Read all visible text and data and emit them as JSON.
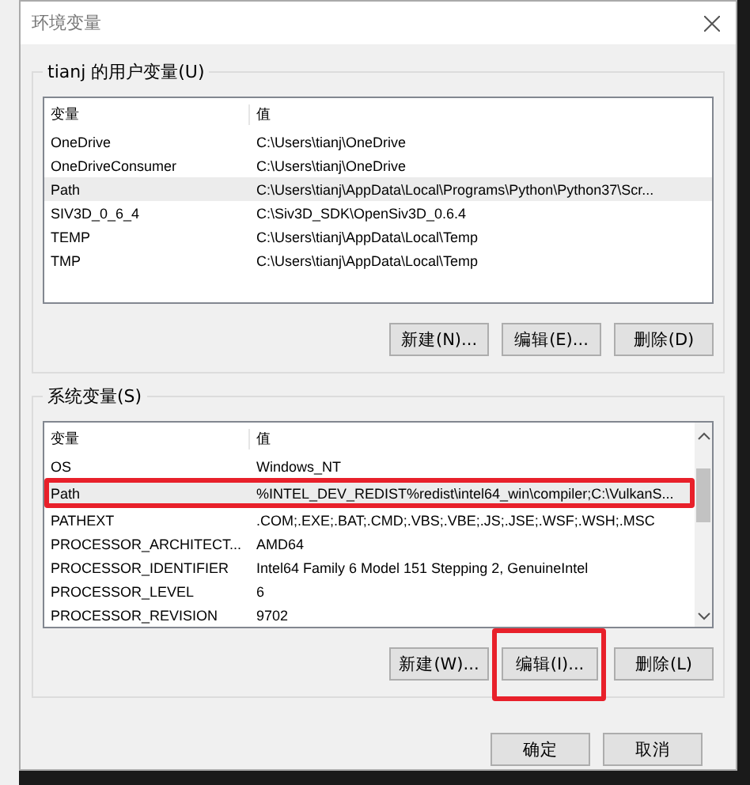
{
  "window": {
    "title": "环境变量"
  },
  "user_vars": {
    "label": "tianj 的用户变量(U)",
    "columns": [
      "变量",
      "值"
    ],
    "rows": [
      {
        "name": "OneDrive",
        "value": "C:\\Users\\tianj\\OneDrive",
        "selected": false,
        "annotated": false
      },
      {
        "name": "OneDriveConsumer",
        "value": "C:\\Users\\tianj\\OneDrive",
        "selected": false,
        "annotated": false
      },
      {
        "name": "Path",
        "value": "C:\\Users\\tianj\\AppData\\Local\\Programs\\Python\\Python37\\Scr...",
        "selected": true,
        "annotated": false
      },
      {
        "name": "SIV3D_0_6_4",
        "value": "C:\\Siv3D_SDK\\OpenSiv3D_0.6.4",
        "selected": false,
        "annotated": false
      },
      {
        "name": "TEMP",
        "value": "C:\\Users\\tianj\\AppData\\Local\\Temp",
        "selected": false,
        "annotated": false
      },
      {
        "name": "TMP",
        "value": "C:\\Users\\tianj\\AppData\\Local\\Temp",
        "selected": false,
        "annotated": false
      }
    ],
    "buttons": [
      {
        "label": "新建(N)...",
        "annotated": false
      },
      {
        "label": "编辑(E)...",
        "annotated": false
      },
      {
        "label": "删除(D)",
        "annotated": false
      }
    ]
  },
  "system_vars": {
    "label": "系统变量(S)",
    "columns": [
      "变量",
      "值"
    ],
    "rows": [
      {
        "name": "OS",
        "value": "Windows_NT",
        "selected": false,
        "annotated": false
      },
      {
        "name": "Path",
        "value": "%INTEL_DEV_REDIST%redist\\intel64_win\\compiler;C:\\VulkanS...",
        "selected": true,
        "annotated": true
      },
      {
        "name": "PATHEXT",
        "value": ".COM;.EXE;.BAT;.CMD;.VBS;.VBE;.JS;.JSE;.WSF;.WSH;.MSC",
        "selected": false,
        "annotated": false
      },
      {
        "name": "PROCESSOR_ARCHITECT...",
        "value": "AMD64",
        "selected": false,
        "annotated": false
      },
      {
        "name": "PROCESSOR_IDENTIFIER",
        "value": "Intel64 Family 6 Model 151 Stepping 2, GenuineIntel",
        "selected": false,
        "annotated": false
      },
      {
        "name": "PROCESSOR_LEVEL",
        "value": "6",
        "selected": false,
        "annotated": false
      },
      {
        "name": "PROCESSOR_REVISION",
        "value": "9702",
        "selected": false,
        "annotated": false
      }
    ],
    "buttons": [
      {
        "label": "新建(W)...",
        "annotated": false
      },
      {
        "label": "编辑(I)...",
        "annotated": true
      },
      {
        "label": "删除(L)",
        "annotated": false
      }
    ]
  },
  "footer_buttons": [
    "确定",
    "取消"
  ]
}
